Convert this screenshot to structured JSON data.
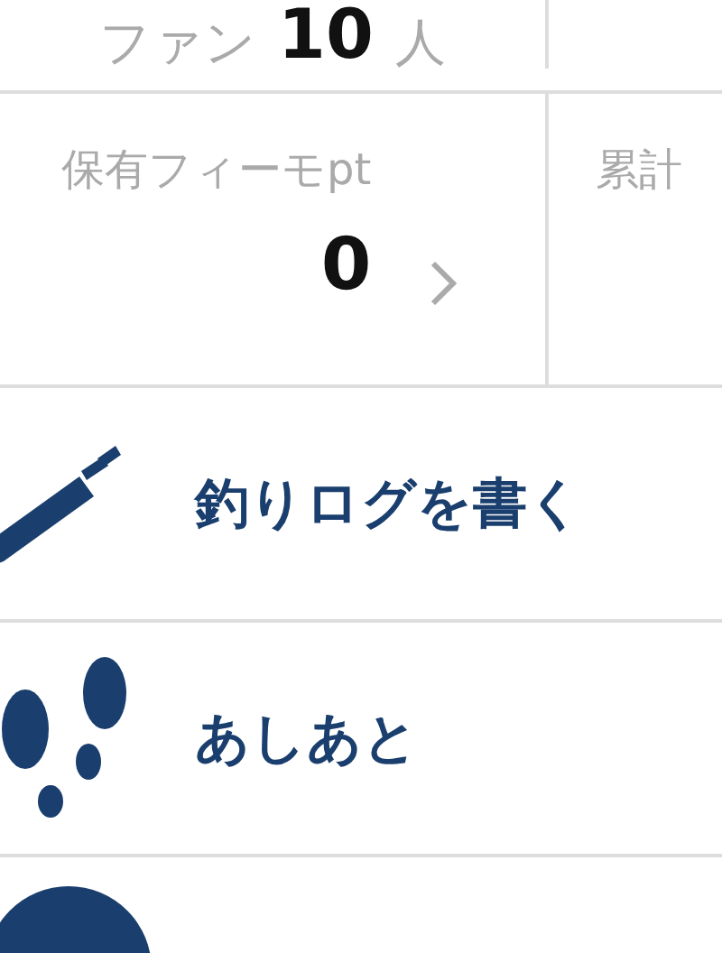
{
  "fans": {
    "label": "ファン",
    "count": "10",
    "unit": "人"
  },
  "stats": [
    {
      "label": "保有フィーモpt",
      "value": "0"
    },
    {
      "label": "累計"
    }
  ],
  "menu": [
    {
      "kind": "pencil",
      "label": "釣りログを書く"
    },
    {
      "kind": "footprints",
      "label": "あしあと"
    },
    {
      "kind": "new"
    }
  ]
}
